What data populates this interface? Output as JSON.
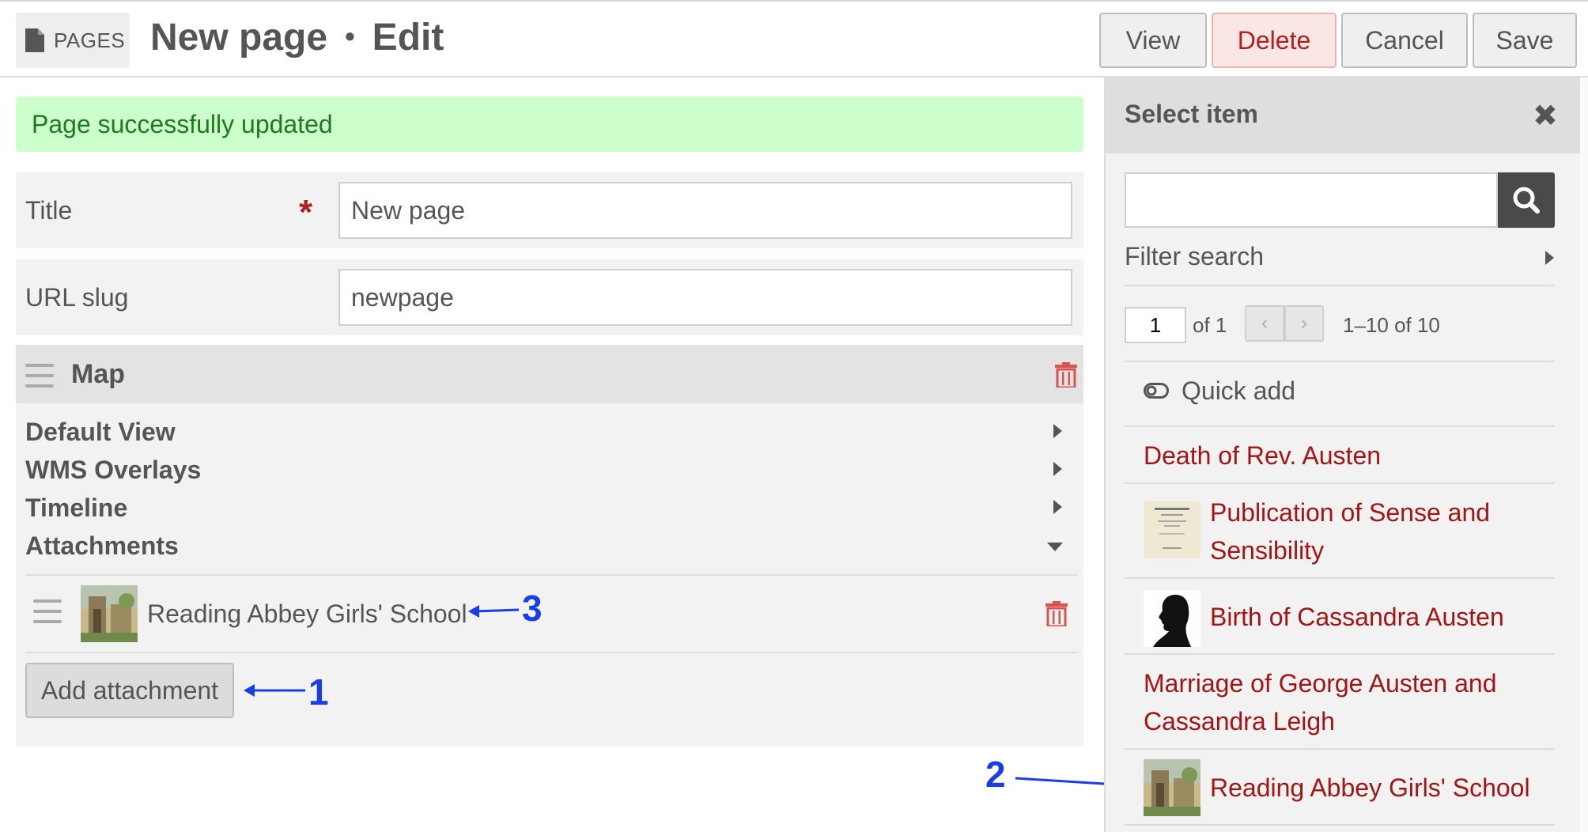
{
  "header": {
    "section_label": "PAGES",
    "title": "New page",
    "separator": "•",
    "mode": "Edit",
    "buttons": {
      "view": "View",
      "delete": "Delete",
      "cancel": "Cancel",
      "save": "Save"
    }
  },
  "alert": {
    "message": "Page successfully updated"
  },
  "form": {
    "title": {
      "label": "Title",
      "required_mark": "*",
      "value": "New page"
    },
    "slug": {
      "label": "URL slug",
      "value": "newpage"
    }
  },
  "map_block": {
    "title": "Map",
    "sections": [
      {
        "label": "Default View",
        "expanded": false
      },
      {
        "label": "WMS Overlays",
        "expanded": false
      },
      {
        "label": "Timeline",
        "expanded": false
      },
      {
        "label": "Attachments",
        "expanded": true
      }
    ],
    "attachments": [
      {
        "name": "Reading Abbey Girls' School"
      }
    ],
    "add_attachment_label": "Add attachment"
  },
  "annotations": {
    "one": "1",
    "two": "2",
    "three": "3"
  },
  "sidebar": {
    "title": "Select item",
    "close_glyph": "✖",
    "search": {
      "value": "",
      "placeholder": ""
    },
    "filter_label": "Filter search",
    "pagination": {
      "page": "1",
      "of_label": "of 1",
      "prev": "‹",
      "next": "›",
      "range": "1–10 of 10"
    },
    "quick_add_label": "Quick add",
    "items": [
      {
        "label": "Death of Rev. Austen",
        "thumb": "none"
      },
      {
        "label": "Publication of Sense and Sensibility",
        "thumb": "book-page"
      },
      {
        "label": "Birth of Cassandra Austen",
        "thumb": "silhouette"
      },
      {
        "label": "Marriage of George Austen and Cassandra Leigh",
        "thumb": "none"
      },
      {
        "label": "Reading Abbey Girls' School",
        "thumb": "abbey"
      }
    ]
  },
  "colors": {
    "accent_red": "#a31515",
    "success_bg": "#ccffcc",
    "annotation_blue": "#1a3ee6"
  }
}
